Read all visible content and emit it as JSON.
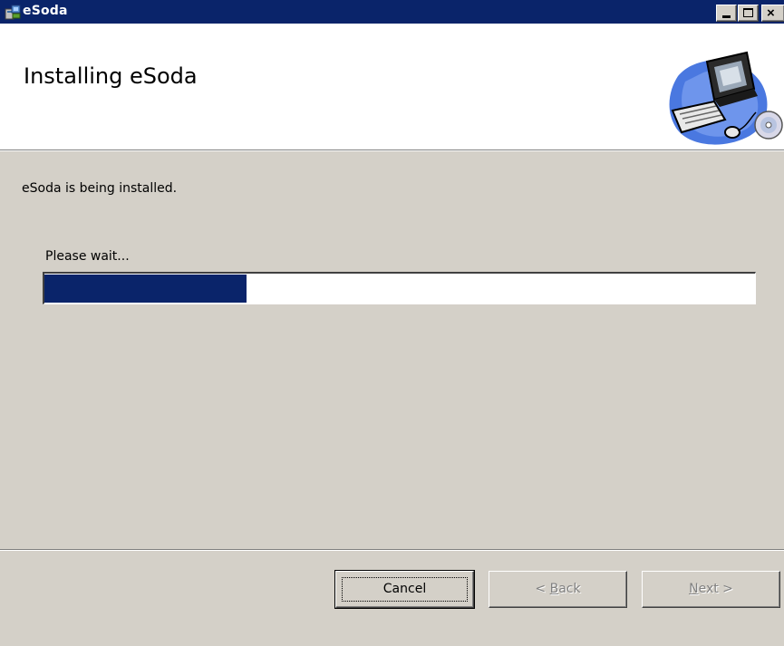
{
  "window": {
    "title": "eSoda",
    "icon": "installer-icon",
    "controls": [
      "minimize-icon",
      "maximize-icon",
      "close-icon"
    ],
    "close_glyph": "×",
    "accent": "#0a246a"
  },
  "header": {
    "title": "Installing eSoda",
    "art": "computer-with-cd-icon"
  },
  "main": {
    "status_text": "eSoda is being installed.",
    "wait_label": "Please wait...",
    "progress_fraction": 0.285,
    "progress_color": "#0a246a"
  },
  "footer": {
    "cancel_label": "Cancel",
    "back_prefix": "< ",
    "back_mnemonic": "B",
    "back_rest": "ack",
    "next_mnemonic": "N",
    "next_rest": "ext >",
    "back_enabled": false,
    "next_enabled": false
  }
}
